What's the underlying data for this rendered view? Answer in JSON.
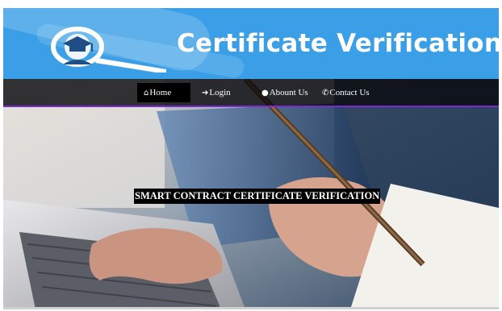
{
  "banner": {
    "title": "Certificate Verification",
    "logo_icon": "graduation-magnifier-icon",
    "background": "#3a9fe6"
  },
  "nav": {
    "items": [
      {
        "label": "Home",
        "icon": "home-icon",
        "active": true
      },
      {
        "label": "Login",
        "icon": "login-icon",
        "active": false
      },
      {
        "label": "Abount Us",
        "icon": "user-icon",
        "active": false
      },
      {
        "label": "Contact Us",
        "icon": "phone-icon",
        "active": false
      }
    ],
    "accent": "#7a2bd0"
  },
  "hero": {
    "title": "SMART CONTRACT CERTIFICATE VERIFICATION",
    "image": "hands-typing-laptop-and-writing-with-pencil"
  }
}
